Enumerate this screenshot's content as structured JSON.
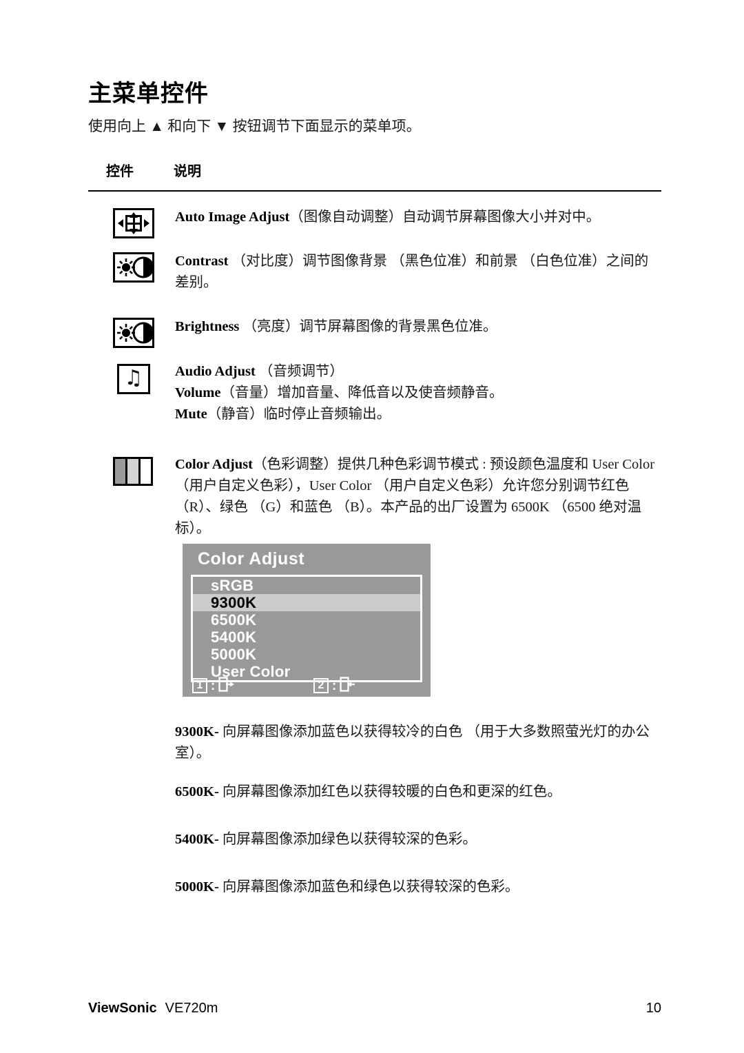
{
  "page": {
    "title": "主菜单控件",
    "intro": "使用向上 ▲ 和向下 ▼ 按钮调节下面显示的菜单项。",
    "columns": {
      "control": "控件",
      "description": "说明"
    }
  },
  "rows": [
    {
      "icon": "auto-image-adjust-icon",
      "term": "Auto Image Adjust",
      "text": "（图像自动调整）自动调节屏幕图像大小并对中。"
    },
    {
      "icon": "contrast-icon",
      "term": "Contrast",
      "text": "（对比度）调节图像背景 （黑色位准）和前景 （白色位准）之间的差别。"
    },
    {
      "icon": "brightness-icon",
      "term": "Brightness",
      "text": "（亮度）调节屏幕图像的背景黑色位准。"
    },
    {
      "icon": "audio-adjust-icon",
      "term": "Audio Adjust",
      "text": "（音频调节）",
      "sublines": [
        {
          "term": "Volume",
          "text": "（音量）增加音量、降低音以及使音频静音。"
        },
        {
          "term": "Mute",
          "text": "（静音）临时停止音频输出。"
        }
      ]
    },
    {
      "icon": "color-adjust-icon",
      "term": "Color Adjust",
      "text": "（色彩调整）提供几种色彩调节模式 : 预设颜色温度和 User Color （用户自定义色彩），User Color （用户自定义色彩）允许您分别调节红色 （R）、绿色 （G）和蓝色 （B）。本产品的出厂设置为 6500K （6500 绝对温标）。"
    }
  ],
  "osd": {
    "title": "Color Adjust",
    "items": [
      {
        "label": "sRGB",
        "selected": false
      },
      {
        "label": "9300K",
        "selected": true
      },
      {
        "label": "6500K",
        "selected": false
      },
      {
        "label": "5400K",
        "selected": false
      },
      {
        "label": "5000K",
        "selected": false
      },
      {
        "label": "User Color",
        "selected": false
      }
    ],
    "keys": [
      {
        "key": "1",
        "sep": ":",
        "icon": "exit-door-right-icon"
      },
      {
        "key": "2",
        "sep": ":",
        "icon": "enter-door-left-icon"
      }
    ],
    "colors": {
      "background": "#999999",
      "selected_row": "#cccccc",
      "border": "#ffffff",
      "text": "#ffffff",
      "selected_text": "#000000"
    }
  },
  "notes": [
    {
      "term": "9300K-",
      "text": "向屏幕图像添加蓝色以获得较冷的白色 （用于大多数照萤光灯的办公室）。"
    },
    {
      "term": "6500K-",
      "text": "向屏幕图像添加红色以获得较暖的白色和更深的红色。"
    },
    {
      "term": "5400K-",
      "text": "向屏幕图像添加绿色以获得较深的色彩。"
    },
    {
      "term": "5000K-",
      "text": "向屏幕图像添加蓝色和绿色以获得较深的色彩。"
    }
  ],
  "footer": {
    "brand": "ViewSonic",
    "model": "VE720m",
    "page_number": "10"
  }
}
